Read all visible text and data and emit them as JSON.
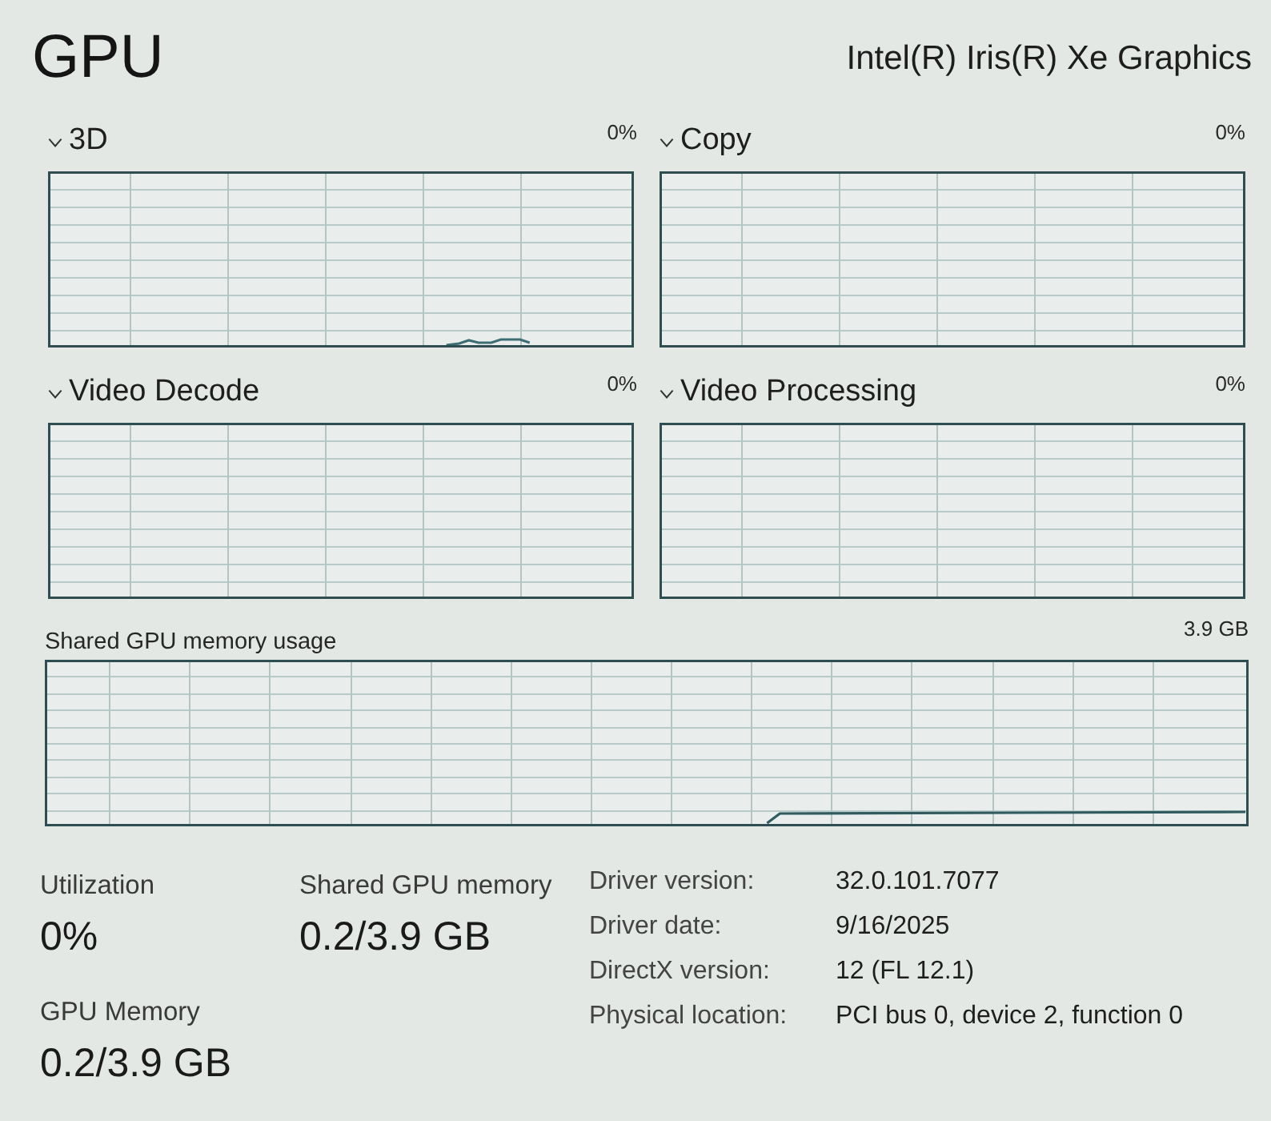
{
  "header": {
    "title": "GPU",
    "device_name": "Intel(R) Iris(R) Xe Graphics"
  },
  "engines": [
    {
      "name": "3D",
      "reading": "0%",
      "kind": "spike"
    },
    {
      "name": "Copy",
      "reading": "0%",
      "kind": "flat"
    },
    {
      "name": "Video Decode",
      "reading": "0%",
      "kind": "flat"
    },
    {
      "name": "Video Processing",
      "reading": "0%",
      "kind": "flat"
    }
  ],
  "memory_graph": {
    "label": "Shared GPU memory usage",
    "max_reading": "3.9 GB",
    "kind": "step"
  },
  "stats": [
    {
      "label": "Utilization",
      "value": "0%"
    },
    {
      "label": "Shared GPU memory",
      "value": "0.2/3.9 GB"
    },
    {
      "label": "GPU Memory",
      "value": "0.2/3.9 GB"
    }
  ],
  "details": [
    {
      "label": "Driver version:",
      "value": "32.0.101.7077"
    },
    {
      "label": "Driver date:",
      "value": "9/16/2025"
    },
    {
      "label": "DirectX version:",
      "value": "12 (FL 12.1)"
    },
    {
      "label": "Physical location:",
      "value": "PCI bus 0, device 2, function 0"
    }
  ]
}
